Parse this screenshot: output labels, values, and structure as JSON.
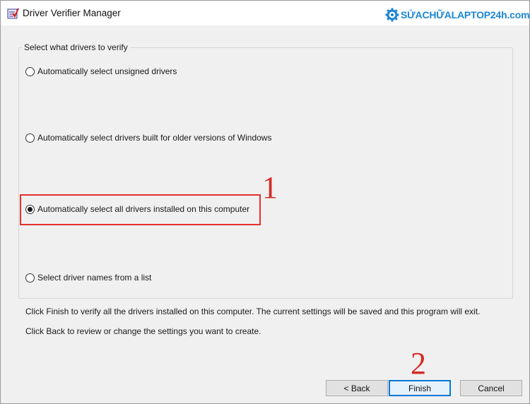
{
  "window": {
    "title": "Driver Verifier Manager",
    "watermark": "SỬACHỮALAPTOP24h.com"
  },
  "group": {
    "label": "Select what drivers to verify",
    "options": [
      {
        "label": "Automatically select unsigned drivers",
        "selected": false
      },
      {
        "label": "Automatically select drivers built for older versions of Windows",
        "selected": false
      },
      {
        "label": "Automatically select all drivers installed on this computer",
        "selected": true
      },
      {
        "label": "Select driver names from a list",
        "selected": false
      }
    ]
  },
  "info": {
    "line1": "Click Finish to verify all the drivers installed on this computer. The current settings will be saved and this program will exit.",
    "line2": "Click Back to review or change the settings you want to create."
  },
  "annotations": {
    "step1": "1",
    "step2": "2"
  },
  "buttons": {
    "back": "< Back",
    "finish": "Finish",
    "cancel": "Cancel"
  },
  "colors": {
    "annotation": "#d42b25",
    "logo": "#1b86d6",
    "default_button_border": "#0078d7"
  }
}
